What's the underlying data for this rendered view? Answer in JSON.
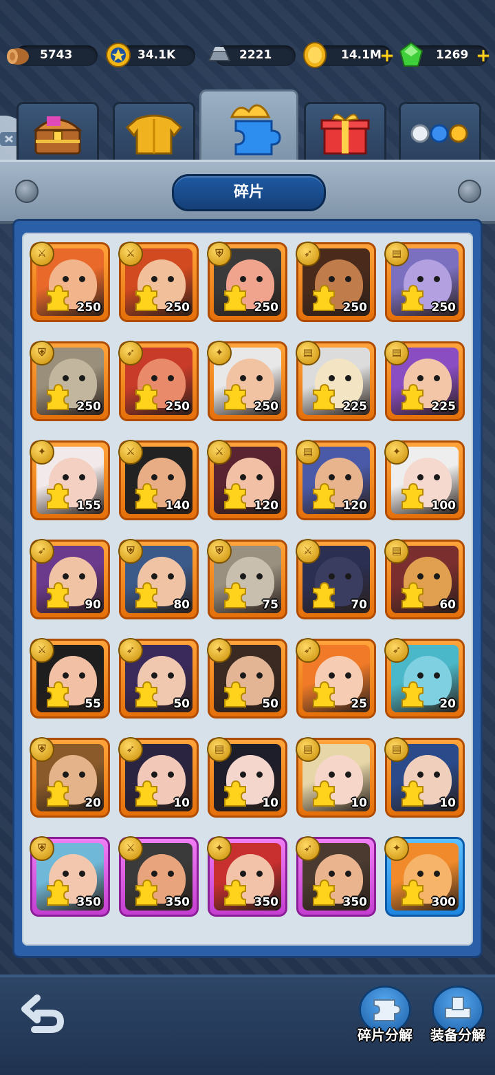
{
  "resources": [
    {
      "name": "wood",
      "value": "5743",
      "icon": "wood-log-icon"
    },
    {
      "name": "gold-medal",
      "value": "34.1K",
      "icon": "star-medal-icon"
    },
    {
      "name": "iron",
      "value": "2221",
      "icon": "iron-ingot-icon"
    },
    {
      "name": "coins",
      "value": "14.1M",
      "icon": "gold-coin-icon",
      "plus": "+"
    },
    {
      "name": "gems",
      "value": "1269",
      "icon": "green-gem-icon",
      "plus": "+"
    }
  ],
  "tabs": [
    {
      "icon": "treasure-chest-icon",
      "active": false
    },
    {
      "icon": "armor-icon",
      "active": false
    },
    {
      "icon": "puzzle-fragment-icon",
      "active": true
    },
    {
      "icon": "gift-box-icon",
      "active": false
    },
    {
      "icon": "orbs-icon",
      "active": false
    }
  ],
  "header": {
    "title": "碎片"
  },
  "fragments": [
    {
      "count": "250",
      "rarity": "orange",
      "class": "sword",
      "hair": "#e9692a",
      "skin": "#f2b48a"
    },
    {
      "count": "250",
      "rarity": "orange",
      "class": "sword",
      "hair": "#d24a1f",
      "skin": "#f1c09b"
    },
    {
      "count": "250",
      "rarity": "orange",
      "class": "shield",
      "hair": "#3a3a3a",
      "skin": "#f0a48e"
    },
    {
      "count": "250",
      "rarity": "orange",
      "class": "bow",
      "hair": "#4a2b1b",
      "skin": "#c07c4a"
    },
    {
      "count": "250",
      "rarity": "orange",
      "class": "book",
      "hair": "#7b6fbf",
      "skin": "#b3a0e0"
    },
    {
      "count": "250",
      "rarity": "orange",
      "class": "shield",
      "hair": "#9a8f7a",
      "skin": "#c2b79e"
    },
    {
      "count": "250",
      "rarity": "orange",
      "class": "bow",
      "hair": "#c73b28",
      "skin": "#e98a6a"
    },
    {
      "count": "250",
      "rarity": "orange",
      "class": "staff",
      "hair": "#e8e8e8",
      "skin": "#f1c3a3"
    },
    {
      "count": "225",
      "rarity": "orange",
      "class": "book",
      "hair": "#dcdcdc",
      "skin": "#f3e4c4"
    },
    {
      "count": "225",
      "rarity": "orange",
      "class": "book",
      "hair": "#8a4dc2",
      "skin": "#f3c6a8"
    },
    {
      "count": "155",
      "rarity": "orange",
      "class": "staff",
      "hair": "#f2eaea",
      "skin": "#f3d0c2"
    },
    {
      "count": "140",
      "rarity": "orange",
      "class": "sword",
      "hair": "#222222",
      "skin": "#e8ad84"
    },
    {
      "count": "120",
      "rarity": "orange",
      "class": "sword",
      "hair": "#5a2430",
      "skin": "#f2c1a5"
    },
    {
      "count": "120",
      "rarity": "orange",
      "class": "book",
      "hair": "#4a5aa8",
      "skin": "#e7b48e"
    },
    {
      "count": "100",
      "rarity": "orange",
      "class": "staff",
      "hair": "#eeeeee",
      "skin": "#f5d8ce"
    },
    {
      "count": "90",
      "rarity": "orange",
      "class": "bow",
      "hair": "#6b3a8c",
      "skin": "#f0c3a4"
    },
    {
      "count": "80",
      "rarity": "orange",
      "class": "shield",
      "hair": "#3b5a8a",
      "skin": "#f0c3a4"
    },
    {
      "count": "75",
      "rarity": "orange",
      "class": "shield",
      "hair": "#9a9080",
      "skin": "#c9bfae"
    },
    {
      "count": "70",
      "rarity": "orange",
      "class": "sword",
      "hair": "#2b2f52",
      "skin": "#3a3d60"
    },
    {
      "count": "60",
      "rarity": "orange",
      "class": "book",
      "hair": "#7a2e2e",
      "skin": "#e0a050"
    },
    {
      "count": "55",
      "rarity": "orange",
      "class": "sword",
      "hair": "#1e1e1e",
      "skin": "#f2c1a5"
    },
    {
      "count": "50",
      "rarity": "orange",
      "class": "bow",
      "hair": "#3a2a5c",
      "skin": "#f0c8b0"
    },
    {
      "count": "50",
      "rarity": "orange",
      "class": "staff",
      "hair": "#3a2a22",
      "skin": "#e3b594"
    },
    {
      "count": "25",
      "rarity": "orange",
      "class": "bow",
      "hair": "#f07a28",
      "skin": "#f6cdb3"
    },
    {
      "count": "20",
      "rarity": "orange",
      "class": "bow",
      "hair": "#4ab8c8",
      "skin": "#7fd0e0"
    },
    {
      "count": "20",
      "rarity": "orange",
      "class": "shield",
      "hair": "#8a5a2a",
      "skin": "#e5b38a"
    },
    {
      "count": "10",
      "rarity": "orange",
      "class": "bow",
      "hair": "#2a2440",
      "skin": "#f2c8b8"
    },
    {
      "count": "10",
      "rarity": "orange",
      "class": "book",
      "hair": "#1e1e2a",
      "skin": "#f5d6cc"
    },
    {
      "count": "10",
      "rarity": "orange",
      "class": "book",
      "hair": "#e6d6a8",
      "skin": "#f5d6c8"
    },
    {
      "count": "10",
      "rarity": "orange",
      "class": "book",
      "hair": "#2a4a8a",
      "skin": "#f0d0bc"
    },
    {
      "count": "350",
      "rarity": "purple",
      "class": "shield",
      "hair": "#6fb8d8",
      "skin": "#f3c6ae"
    },
    {
      "count": "350",
      "rarity": "purple",
      "class": "sword",
      "hair": "#3a3a3a",
      "skin": "#e8a47c"
    },
    {
      "count": "350",
      "rarity": "purple",
      "class": "staff",
      "hair": "#c83030",
      "skin": "#f2c3a8"
    },
    {
      "count": "350",
      "rarity": "purple",
      "class": "bow",
      "hair": "#4a3a30",
      "skin": "#e9b48e"
    },
    {
      "count": "300",
      "rarity": "blue",
      "class": "staff",
      "hair": "#f08a2a",
      "skin": "#f5b46a"
    }
  ],
  "bottom": {
    "fragment_decompose_label": "碎片分解",
    "equipment_decompose_label": "装备分解"
  },
  "colors": {
    "accent": "#1e5aa3",
    "gold": "#ffd21c",
    "orange_card": "#ff9a2a",
    "purple_card": "#d84fe0",
    "blue_card": "#2e95f0"
  }
}
